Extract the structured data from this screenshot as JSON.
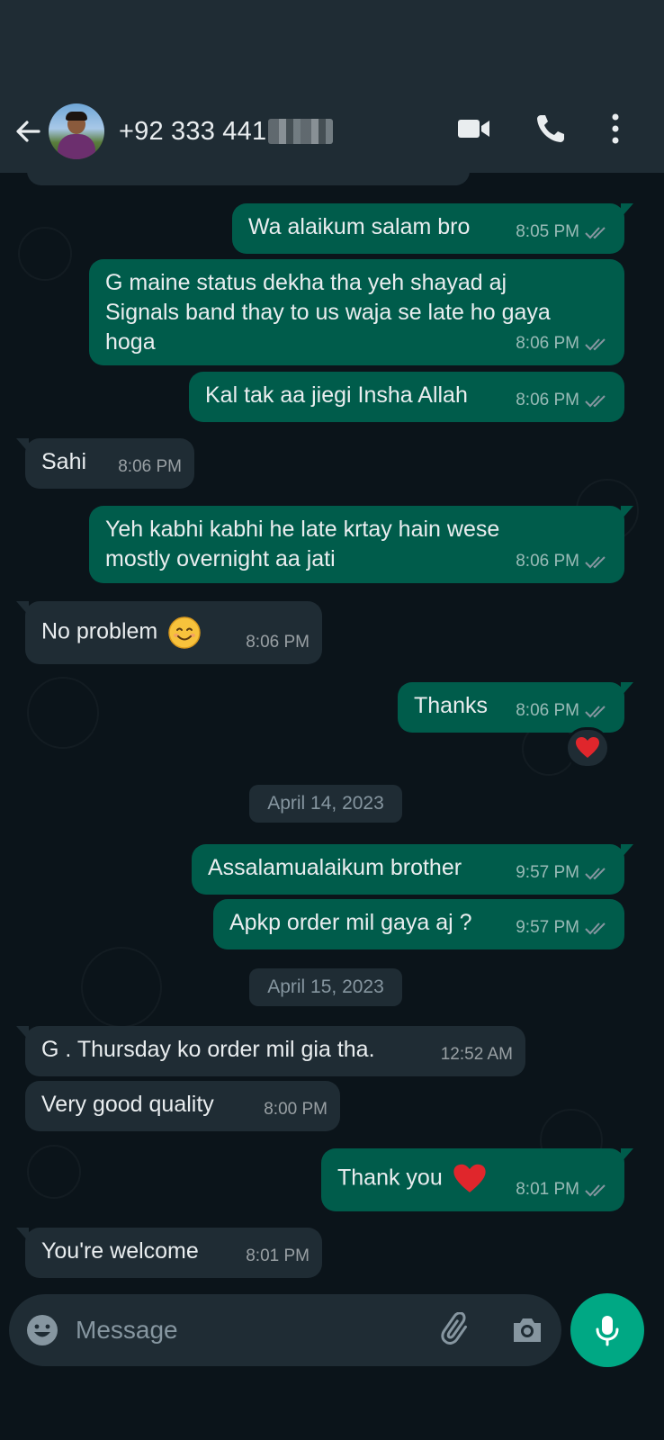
{
  "header": {
    "contact_name": "+92 333 441",
    "back_icon": "arrow-left-icon",
    "video_icon": "video-call-icon",
    "call_icon": "phone-icon",
    "menu_icon": "more-vert-icon"
  },
  "colors": {
    "outgoing_bubble": "#005c4b",
    "incoming_bubble": "#1f2c34",
    "background": "#0b141a",
    "accent": "#00a884"
  },
  "messages": [
    {
      "dir": "out",
      "text": "Wa alaikum salam bro",
      "time": "8:05 PM"
    },
    {
      "dir": "out",
      "lines": [
        "G maine status dekha tha yeh shayad aj",
        "Signals band thay to us waja se late ho gaya",
        "hoga"
      ],
      "time": "8:06 PM"
    },
    {
      "dir": "out",
      "text": "Kal tak aa jiegi Insha Allah",
      "time": "8:06 PM"
    },
    {
      "dir": "in",
      "text": "Sahi",
      "time": "8:06 PM"
    },
    {
      "dir": "out",
      "lines": [
        "Yeh kabhi kabhi he late krtay hain wese",
        "mostly overnight aa jati"
      ],
      "time": "8:06 PM"
    },
    {
      "dir": "in",
      "text": "No problem",
      "emoji": "smiling-face-emoji",
      "time": "8:06 PM"
    },
    {
      "dir": "out",
      "text": "Thanks",
      "time": "8:06 PM",
      "reaction": "red-heart-emoji"
    },
    {
      "dir": "out",
      "text": "Assalamualaikum brother",
      "time": "9:57 PM"
    },
    {
      "dir": "out",
      "text": "Apkp order mil gaya aj ?",
      "time": "9:57 PM"
    },
    {
      "dir": "in",
      "text": "G . Thursday ko order mil gia tha.",
      "time": "12:52 AM"
    },
    {
      "dir": "in",
      "text": "Very good quality",
      "time": "8:00 PM"
    },
    {
      "dir": "out",
      "text": "Thank you",
      "emoji": "red-heart-emoji",
      "time": "8:01 PM"
    },
    {
      "dir": "in",
      "text": "You're welcome",
      "time": "8:01 PM"
    }
  ],
  "dates": [
    "April 14, 2023",
    "April 15, 2023"
  ],
  "composer": {
    "placeholder": "Message",
    "emoji_icon": "emoji-icon",
    "attach_icon": "paperclip-icon",
    "camera_icon": "camera-icon",
    "mic_icon": "microphone-icon"
  }
}
